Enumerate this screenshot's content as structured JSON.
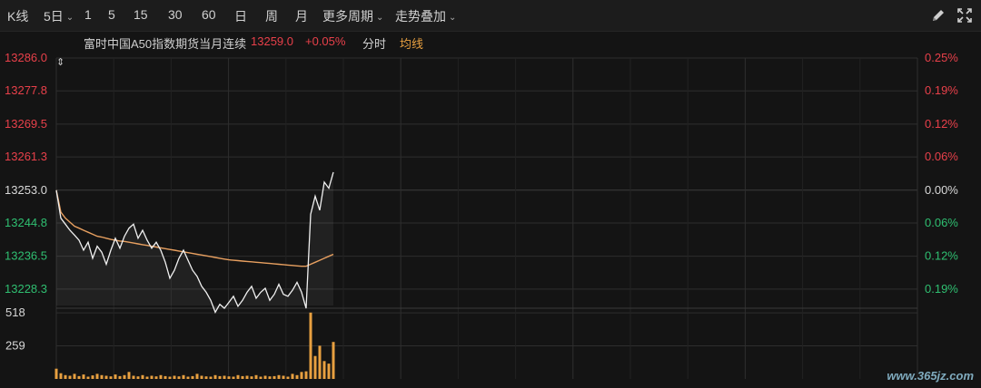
{
  "toolbar": {
    "items": [
      "K线",
      "5日",
      "1",
      "5",
      "15",
      "30",
      "60",
      "日",
      "周",
      "月",
      "更多周期",
      "走势叠加"
    ],
    "pen_icon": "pen-icon",
    "expand_icon": "expand-icon"
  },
  "info_bar": {
    "instrument": "富时中国A50指数期货当月连续",
    "price": "13259.0",
    "change_pct": "+0.05%",
    "mode": "分时",
    "avg_label": "均线"
  },
  "colors": {
    "background": "#141414",
    "grid": "#2e2e2e",
    "up": "#e8404a",
    "down": "#2fbf71",
    "neutral": "#d8d8d8",
    "price_line": "#f0f0f0",
    "avg_line": "#e8a060",
    "volume": "#e8a040"
  },
  "watermark": "www.365jz.com",
  "chart_data": {
    "type": "line",
    "title": "",
    "y_left_labels": [
      "13286.0",
      "13277.8",
      "13269.5",
      "13261.3",
      "13253.0",
      "13244.8",
      "13236.5",
      "13228.3"
    ],
    "y_right_labels": [
      "0.25%",
      "0.19%",
      "0.12%",
      "0.06%",
      "0.00%",
      "0.06%",
      "0.12%",
      "0.19%"
    ],
    "ylim": [
      13224.2,
      13286.0
    ],
    "prev_close": 13253.0,
    "days": 5,
    "price": [
      13253.0,
      13246.0,
      13244.5,
      13243.0,
      13241.8,
      13240.5,
      13238.0,
      13240.0,
      13236.0,
      13239.0,
      13237.5,
      13234.5,
      13238.0,
      13241.0,
      13238.5,
      13241.5,
      13243.5,
      13244.5,
      13241.0,
      13243.0,
      13240.5,
      13238.5,
      13240.0,
      13238.0,
      13235.0,
      13231.0,
      13233.0,
      13236.0,
      13238.0,
      13235.5,
      13233.0,
      13231.5,
      13229.0,
      13227.5,
      13225.5,
      13222.5,
      13224.5,
      13223.5,
      13225.0,
      13226.5,
      13224.0,
      13225.5,
      13227.5,
      13229.0,
      13226.0,
      13227.5,
      13228.5,
      13225.5,
      13227.0,
      13229.5,
      13227.0,
      13226.5,
      13228.0,
      13230.0,
      13227.5,
      13223.5,
      13247.0,
      13251.5,
      13248.0,
      13255.0,
      13253.5,
      13257.5
    ],
    "avg": [
      13253.0,
      13247.5,
      13246.0,
      13245.0,
      13244.0,
      13243.5,
      13243.0,
      13242.5,
      13242.0,
      13241.5,
      13241.3,
      13241.0,
      13240.7,
      13240.5,
      13240.3,
      13240.2,
      13240.0,
      13239.8,
      13239.6,
      13239.4,
      13239.2,
      13239.0,
      13238.8,
      13238.6,
      13238.4,
      13238.2,
      13238.0,
      13237.8,
      13237.6,
      13237.4,
      13237.2,
      13237.0,
      13236.8,
      13236.6,
      13236.4,
      13236.2,
      13236.0,
      13235.8,
      13235.6,
      13235.5,
      13235.4,
      13235.3,
      13235.2,
      13235.1,
      13235.0,
      13234.9,
      13234.8,
      13234.7,
      13234.6,
      13234.5,
      13234.4,
      13234.3,
      13234.2,
      13234.1,
      13234.0,
      13234.0,
      13234.5,
      13235.0,
      13235.5,
      13236.0,
      13236.5,
      13237.0
    ],
    "volume_labels": [
      "518",
      "259"
    ],
    "volume_ylim": [
      0,
      540
    ],
    "volume": [
      80,
      45,
      30,
      25,
      40,
      22,
      35,
      18,
      28,
      40,
      30,
      25,
      20,
      35,
      22,
      30,
      55,
      25,
      20,
      30,
      18,
      25,
      20,
      30,
      22,
      18,
      25,
      20,
      30,
      18,
      22,
      40,
      25,
      20,
      18,
      30,
      22,
      25,
      20,
      18,
      30,
      22,
      25,
      20,
      30,
      18,
      25,
      20,
      22,
      30,
      25,
      18,
      40,
      30,
      55,
      60,
      520,
      180,
      260,
      140,
      120,
      290
    ]
  }
}
